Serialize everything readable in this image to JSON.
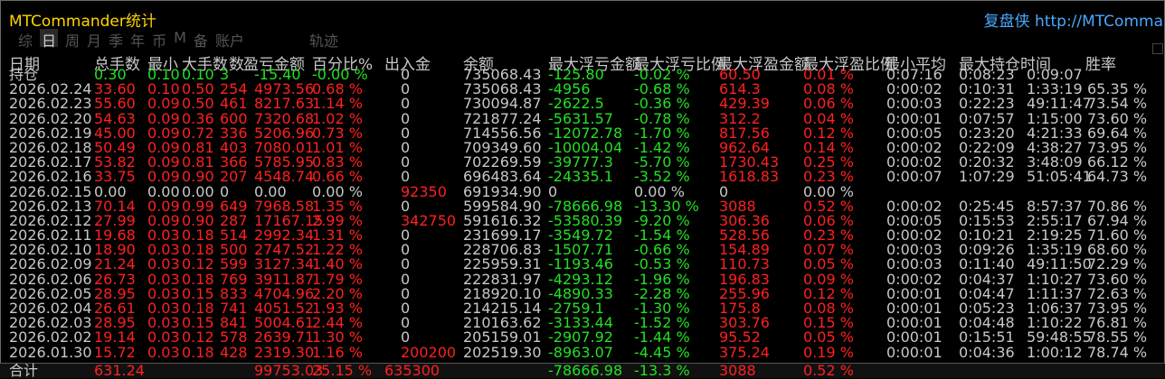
{
  "title": "MTCommander统计",
  "link": "复盘侠 http://MTComma",
  "periods": [
    {
      "label": "综",
      "active": false
    },
    {
      "label": "日",
      "active": true
    },
    {
      "label": "周",
      "active": false
    },
    {
      "label": "月",
      "active": false
    },
    {
      "label": "季",
      "active": false
    },
    {
      "label": "年",
      "active": false
    },
    {
      "label": "币",
      "active": false
    },
    {
      "label": "M",
      "active": false
    },
    {
      "label": "备",
      "active": false
    },
    {
      "label": "账户",
      "active": false
    }
  ],
  "periods_trail": "轨迹",
  "headers": [
    "日期",
    "总手数",
    "最小",
    "大手数",
    "数",
    "盈亏金额",
    "百分比%",
    "出入金",
    "余额",
    "最大浮亏金额",
    "最大浮亏比例",
    "最大浮盈金额",
    "最大浮盈比例",
    "最小平均",
    "最大持仓时间",
    "胜率"
  ],
  "sub_header": "持仓",
  "colors": {
    "red": "#ff2020",
    "green": "#22e022",
    "white": "#c8c8c8",
    "yellow": "#ffd400",
    "link": "#4aa8ff"
  },
  "rows": [
    {
      "date": "持仓",
      "lots": "0.30",
      "min": "0.10",
      "max": "0.10",
      "n": "3",
      "pnl": "-15.40",
      "pct": "-0.00 %",
      "io": "0",
      "bal": "735068.43",
      "mfl": "-125.80",
      "mflp": "-0.02 %",
      "mfp": "60.50",
      "mfpp": "0.01 %",
      "t1": "0:07:16",
      "t2": "0:08:23",
      "t3": "0:09:07",
      "win": "",
      "color": "g"
    },
    {
      "date": "2026.02.24",
      "lots": "33.60",
      "min": "0.10",
      "max": "0.50",
      "n": "254",
      "pnl": "4973.56",
      "pct": "0.68 %",
      "io": "0",
      "bal": "735068.43",
      "mfl": "-4956",
      "mflp": "-0.68 %",
      "mfp": "614.3",
      "mfpp": "0.08 %",
      "t1": "0:00:02",
      "t2": "0:10:31",
      "t3": "1:33:19",
      "win": "65.35 %",
      "color": "r"
    },
    {
      "date": "2026.02.23",
      "lots": "55.60",
      "min": "0.09",
      "max": "0.50",
      "n": "461",
      "pnl": "8217.63",
      "pct": "1.14 %",
      "io": "0",
      "bal": "730094.87",
      "mfl": "-2622.5",
      "mflp": "-0.36 %",
      "mfp": "429.39",
      "mfpp": "0.06 %",
      "t1": "0:00:03",
      "t2": "0:22:23",
      "t3": "49:11:47",
      "win": "73.54 %",
      "color": "r"
    },
    {
      "date": "2026.02.20",
      "lots": "54.63",
      "min": "0.09",
      "max": "0.36",
      "n": "600",
      "pnl": "7320.68",
      "pct": "1.02 %",
      "io": "0",
      "bal": "721877.24",
      "mfl": "-5631.57",
      "mflp": "-0.78 %",
      "mfp": "312.2",
      "mfpp": "0.04 %",
      "t1": "0:00:01",
      "t2": "0:07:57",
      "t3": "1:15:00",
      "win": "73.60 %",
      "color": "r"
    },
    {
      "date": "2026.02.19",
      "lots": "45.00",
      "min": "0.09",
      "max": "0.72",
      "n": "336",
      "pnl": "5206.96",
      "pct": "0.73 %",
      "io": "0",
      "bal": "714556.56",
      "mfl": "-12072.78",
      "mflp": "-1.70 %",
      "mfp": "817.56",
      "mfpp": "0.12 %",
      "t1": "0:00:05",
      "t2": "0:23:20",
      "t3": "4:21:33",
      "win": "69.64 %",
      "color": "r"
    },
    {
      "date": "2026.02.18",
      "lots": "50.49",
      "min": "0.09",
      "max": "0.81",
      "n": "403",
      "pnl": "7080.01",
      "pct": "1.01 %",
      "io": "0",
      "bal": "709349.60",
      "mfl": "-10004.04",
      "mflp": "-1.42 %",
      "mfp": "962.64",
      "mfpp": "0.14 %",
      "t1": "0:00:02",
      "t2": "0:22:09",
      "t3": "4:38:27",
      "win": "73.95 %",
      "color": "r"
    },
    {
      "date": "2026.02.17",
      "lots": "53.82",
      "min": "0.09",
      "max": "0.81",
      "n": "366",
      "pnl": "5785.95",
      "pct": "0.83 %",
      "io": "0",
      "bal": "702269.59",
      "mfl": "-39777.3",
      "mflp": "-5.70 %",
      "mfp": "1730.43",
      "mfpp": "0.25 %",
      "t1": "0:00:02",
      "t2": "0:20:32",
      "t3": "3:48:09",
      "win": "66.12 %",
      "color": "r"
    },
    {
      "date": "2026.02.16",
      "lots": "33.75",
      "min": "0.09",
      "max": "0.90",
      "n": "207",
      "pnl": "4548.74",
      "pct": "0.66 %",
      "io": "0",
      "bal": "696483.64",
      "mfl": "-24335.1",
      "mflp": "-3.52 %",
      "mfp": "1618.83",
      "mfpp": "0.23 %",
      "t1": "0:00:07",
      "t2": "1:07:29",
      "t3": "51:05:41",
      "win": "64.73 %",
      "color": "r"
    },
    {
      "date": "2026.02.15",
      "lots": "0.00",
      "min": "0.00",
      "max": "0.00",
      "n": "0",
      "pnl": "0.00",
      "pct": "0.00 %",
      "io": "92350",
      "bal": "691934.90",
      "mfl": "0",
      "mflp": "0.00 %",
      "mfp": "0",
      "mfpp": "0.00 %",
      "t1": "",
      "t2": "",
      "t3": "",
      "win": "",
      "color": "w"
    },
    {
      "date": "2026.02.13",
      "lots": "70.14",
      "min": "0.09",
      "max": "0.99",
      "n": "649",
      "pnl": "7968.58",
      "pct": "1.35 %",
      "io": "0",
      "bal": "599584.90",
      "mfl": "-78666.98",
      "mflp": "-13.30 %",
      "mfp": "3088",
      "mfpp": "0.52 %",
      "t1": "0:00:02",
      "t2": "0:25:45",
      "t3": "8:57:37",
      "win": "70.86 %",
      "color": "r"
    },
    {
      "date": "2026.02.12",
      "lots": "27.99",
      "min": "0.09",
      "max": "0.90",
      "n": "287",
      "pnl": "17167.15",
      "pct": "2.99 %",
      "io": "342750",
      "bal": "591616.32",
      "mfl": "-53580.39",
      "mflp": "-9.20 %",
      "mfp": "306.36",
      "mfpp": "0.06 %",
      "t1": "0:00:05",
      "t2": "0:15:53",
      "t3": "2:55:17",
      "win": "67.94 %",
      "color": "r"
    },
    {
      "date": "2026.02.11",
      "lots": "19.68",
      "min": "0.03",
      "max": "0.18",
      "n": "514",
      "pnl": "2992.34",
      "pct": "1.31 %",
      "io": "0",
      "bal": "231699.17",
      "mfl": "-3549.72",
      "mflp": "-1.54 %",
      "mfp": "528.56",
      "mfpp": "0.23 %",
      "t1": "0:00:02",
      "t2": "0:10:21",
      "t3": "2:19:25",
      "win": "71.60 %",
      "color": "r"
    },
    {
      "date": "2026.02.10",
      "lots": "18.90",
      "min": "0.03",
      "max": "0.18",
      "n": "500",
      "pnl": "2747.52",
      "pct": "1.22 %",
      "io": "0",
      "bal": "228706.83",
      "mfl": "-1507.71",
      "mflp": "-0.66 %",
      "mfp": "154.89",
      "mfpp": "0.07 %",
      "t1": "0:00:03",
      "t2": "0:09:26",
      "t3": "1:35:19",
      "win": "68.60 %",
      "color": "r"
    },
    {
      "date": "2026.02.09",
      "lots": "21.24",
      "min": "0.03",
      "max": "0.12",
      "n": "599",
      "pnl": "3127.34",
      "pct": "1.40 %",
      "io": "0",
      "bal": "225959.31",
      "mfl": "-1193.46",
      "mflp": "-0.53 %",
      "mfp": "110.73",
      "mfpp": "0.05 %",
      "t1": "0:00:03",
      "t2": "0:11:40",
      "t3": "49:11:50",
      "win": "72.29 %",
      "color": "r"
    },
    {
      "date": "2026.02.06",
      "lots": "26.73",
      "min": "0.03",
      "max": "0.18",
      "n": "769",
      "pnl": "3911.87",
      "pct": "1.79 %",
      "io": "0",
      "bal": "222831.97",
      "mfl": "-4293.12",
      "mflp": "-1.96 %",
      "mfp": "196.83",
      "mfpp": "0.09 %",
      "t1": "0:00:02",
      "t2": "0:04:37",
      "t3": "1:10:27",
      "win": "73.60 %",
      "color": "r"
    },
    {
      "date": "2026.02.05",
      "lots": "28.95",
      "min": "0.03",
      "max": "0.15",
      "n": "833",
      "pnl": "4704.96",
      "pct": "2.20 %",
      "io": "0",
      "bal": "218920.10",
      "mfl": "-4890.33",
      "mflp": "-2.28 %",
      "mfp": "255.96",
      "mfpp": "0.12 %",
      "t1": "0:00:01",
      "t2": "0:04:47",
      "t3": "1:11:37",
      "win": "72.63 %",
      "color": "r"
    },
    {
      "date": "2026.02.04",
      "lots": "26.61",
      "min": "0.03",
      "max": "0.18",
      "n": "741",
      "pnl": "4051.52",
      "pct": "1.93 %",
      "io": "0",
      "bal": "214215.14",
      "mfl": "-2759.1",
      "mflp": "-1.30 %",
      "mfp": "175.8",
      "mfpp": "0.08 %",
      "t1": "0:00:01",
      "t2": "0:05:23",
      "t3": "1:06:37",
      "win": "73.95 %",
      "color": "r"
    },
    {
      "date": "2026.02.03",
      "lots": "28.95",
      "min": "0.03",
      "max": "0.15",
      "n": "841",
      "pnl": "5004.61",
      "pct": "2.44 %",
      "io": "0",
      "bal": "210163.62",
      "mfl": "-3133.44",
      "mflp": "-1.52 %",
      "mfp": "303.76",
      "mfpp": "0.15 %",
      "t1": "0:00:01",
      "t2": "0:04:48",
      "t3": "1:10:22",
      "win": "76.81 %",
      "color": "r"
    },
    {
      "date": "2026.02.02",
      "lots": "19.14",
      "min": "0.03",
      "max": "0.12",
      "n": "578",
      "pnl": "2639.71",
      "pct": "1.30 %",
      "io": "0",
      "bal": "205159.01",
      "mfl": "-2907.92",
      "mflp": "-1.44 %",
      "mfp": "95.52",
      "mfpp": "0.05 %",
      "t1": "0:00:01",
      "t2": "0:15:51",
      "t3": "59:48:55",
      "win": "78.55 %",
      "color": "r"
    },
    {
      "date": "2026.01.30",
      "lots": "15.72",
      "min": "0.03",
      "max": "0.18",
      "n": "428",
      "pnl": "2319.30",
      "pct": "1.16 %",
      "io": "200200",
      "bal": "202519.30",
      "mfl": "-8963.07",
      "mflp": "-4.45 %",
      "mfp": "375.24",
      "mfpp": "0.19 %",
      "t1": "0:00:01",
      "t2": "0:04:36",
      "t3": "1:00:12",
      "win": "78.74 %",
      "color": "r"
    }
  ],
  "total": {
    "date": "合计",
    "lots": "631.24",
    "pnl": "99753.03",
    "pct": "25.15 %",
    "io": "635300",
    "mfl": "-78666.98",
    "mflp": "-13.3 %",
    "mfp": "3088",
    "mfpp": "0.52 %"
  }
}
